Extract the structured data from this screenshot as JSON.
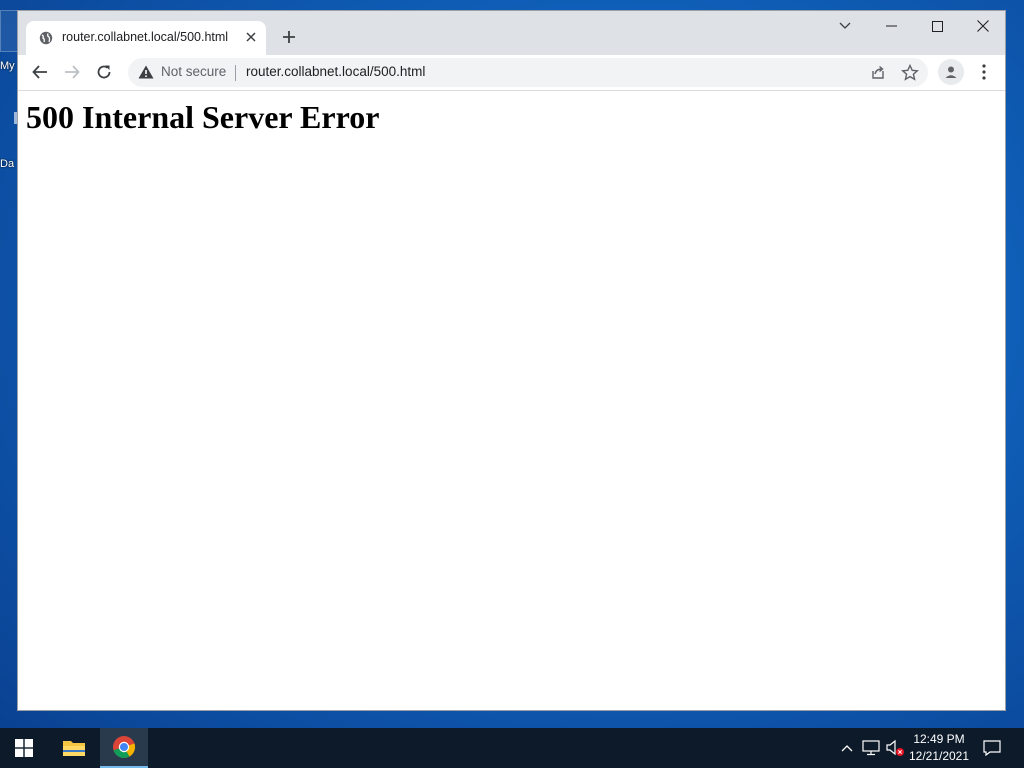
{
  "desktop": {
    "icon1_label": "My",
    "icon2_label": "Da"
  },
  "browser": {
    "tab_title": "router.collabnet.local/500.html",
    "security_label": "Not secure",
    "url": "router.collabnet.local/500.html",
    "icons": [
      "globe-icon",
      "close-icon",
      "plus-icon",
      "chevron-down-icon",
      "minimize-icon",
      "maximize-icon",
      "close-window-icon",
      "back-arrow-icon",
      "forward-arrow-icon",
      "reload-icon",
      "warning-icon",
      "share-icon",
      "star-icon",
      "profile-icon",
      "more-vert-icon"
    ]
  },
  "page": {
    "heading": "500 Internal Server Error"
  },
  "taskbar": {
    "time": "12:49 PM",
    "date": "12/21/2021",
    "icons": [
      "windows-start-icon",
      "file-explorer-icon",
      "chrome-icon",
      "chevron-up-icon",
      "network-icon",
      "volume-muted-icon",
      "notification-icon"
    ]
  },
  "colors": {
    "desktop": "#0f5fb8",
    "titlebar": "#dee1e6",
    "taskbar": "#0c1a2a"
  }
}
